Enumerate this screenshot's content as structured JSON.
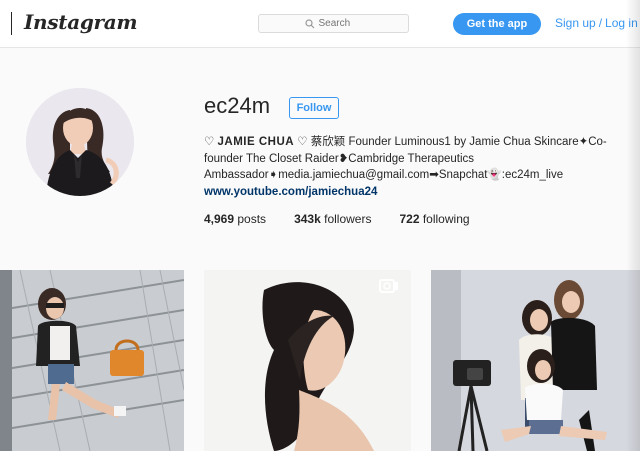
{
  "header": {
    "logo_text": "Instagram",
    "search_placeholder": "Search",
    "get_app_label": "Get the app",
    "sign_up_label": "Sign up",
    "separator": "/",
    "log_in_label": "Log in"
  },
  "profile": {
    "username": "ec24m",
    "follow_label": "Follow",
    "bio": {
      "line1_prefix": "♡ ",
      "display_name": "JAMIE CHUA",
      "line1_suffix": " ♡ 蔡欣颖 Founder Luminous1 by Jamie Chua Skincare✦Co-",
      "line2": "founder The Closet Raider❥Cambridge Therapeutics",
      "line3": "Ambassador➧media.jamiechua@gmail.com➡Snapchat👻:ec24m_live",
      "website": "www.youtube.com/jamiechua24"
    },
    "stats": {
      "posts_count": "4,969",
      "posts_label": "posts",
      "followers_count": "343k",
      "followers_label": "followers",
      "following_count": "722",
      "following_label": "following"
    }
  },
  "colors": {
    "accent": "#3897f0",
    "link": "#003569",
    "text": "#262626",
    "background": "#fafafa"
  },
  "icons": {
    "search": "search-icon",
    "video_badge": "video-icon"
  }
}
